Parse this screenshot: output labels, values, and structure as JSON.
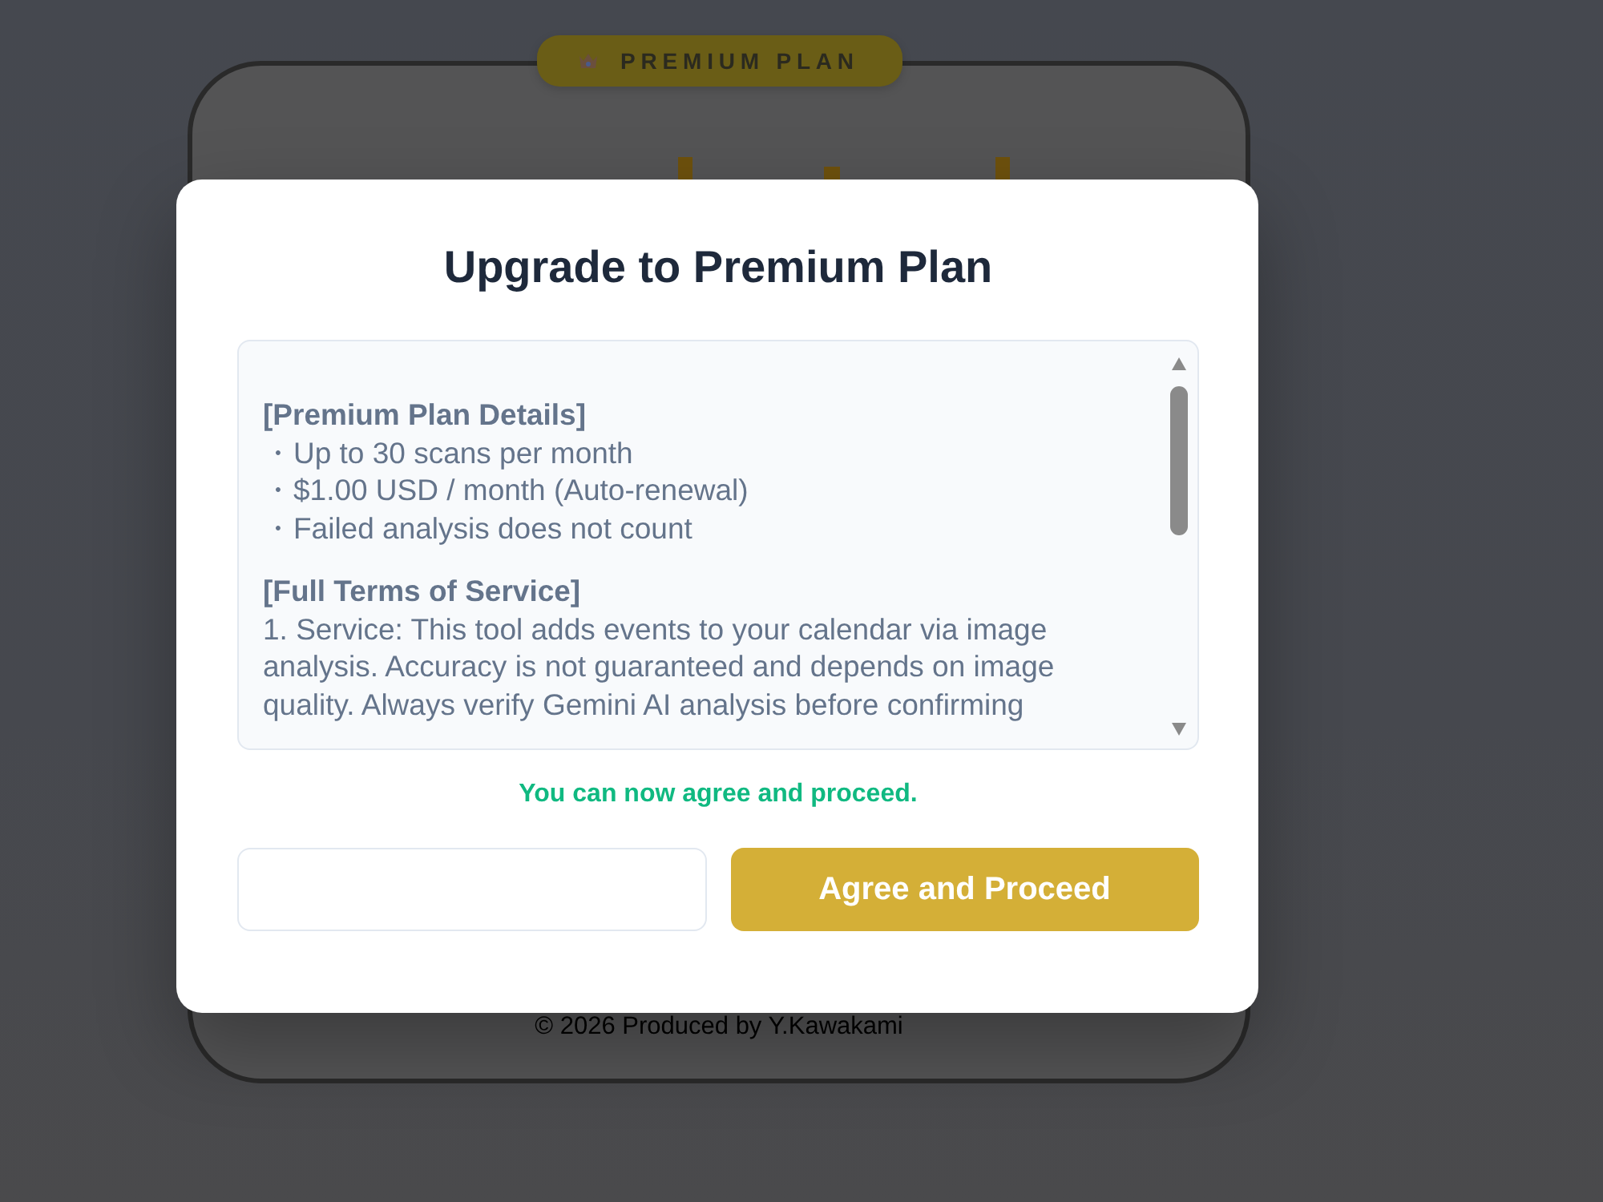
{
  "background_card": {
    "badge": {
      "label": "PREMIUM PLAN"
    },
    "footer": "© 2026 Produced by Y.Kawakami"
  },
  "dialog": {
    "title": "Upgrade to Premium Plan",
    "terms": [
      {
        "kind": "list",
        "heading": "[Premium Plan Details]",
        "lines": [
          "・Up to 30 scans per month",
          "・$1.00 USD / month (Auto-renewal)",
          "・Failed analysis does not count"
        ]
      },
      {
        "kind": "text",
        "heading": "[Full Terms of Service]",
        "lines": [
          "1. Service: This tool adds events to your calendar via image analysis. Accuracy is not guaranteed and depends on image quality. Always verify Gemini AI analysis before confirming"
        ]
      }
    ],
    "status": "You can now agree and proceed.",
    "buttons": [
      {
        "kind": "blank"
      },
      {
        "kind": "primary",
        "label": "Agree and Proceed"
      }
    ]
  }
}
